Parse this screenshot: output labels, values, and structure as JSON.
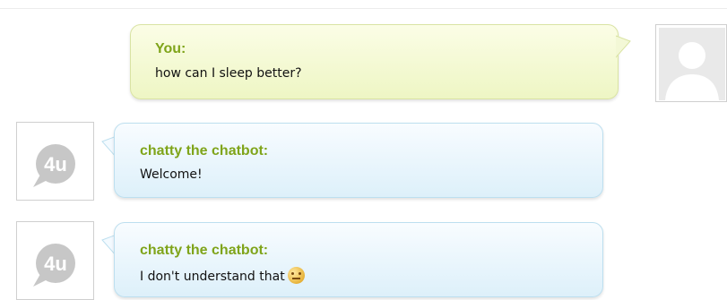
{
  "colors": {
    "speaker_green": "#7fa41a",
    "user_bubble": "#eef6c4",
    "bot_bubble": "#ddf0fa"
  },
  "messages": [
    {
      "speaker": "You:",
      "text": "how can I sleep better?",
      "avatar": "default-user-silhouette-icon"
    },
    {
      "speaker": "chatty the chatbot:",
      "text": "Welcome!",
      "avatar": "bot-4u-icon",
      "avatar_text": "4u"
    },
    {
      "speaker": "chatty the chatbot:",
      "text": "I don't understand that",
      "avatar": "bot-4u-icon",
      "avatar_text": "4u",
      "emoji": "confused-face-emoji"
    }
  ]
}
